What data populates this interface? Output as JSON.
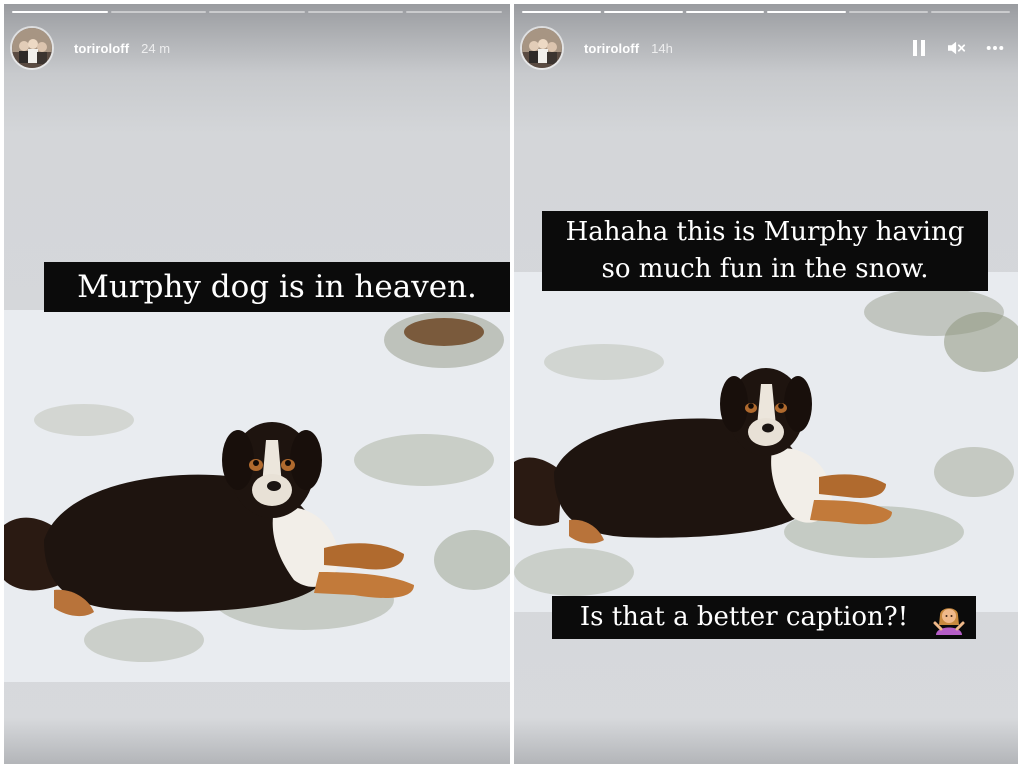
{
  "stories": [
    {
      "username": "toriroloff",
      "timestamp": "24 m",
      "caption": "Murphy dog is in heaven.",
      "progress": {
        "segments": 5,
        "completed": 1
      },
      "avatar_icon": "profile-photo"
    },
    {
      "username": "toriroloff",
      "timestamp": "14h",
      "caption_top_line1": "Hahaha this is Murphy having",
      "caption_top_line2": "so much fun in the snow.",
      "caption_bottom": "Is that a better caption?!",
      "caption_emoji_icon": "woman-shrugging-emoji",
      "progress": {
        "segments": 6,
        "completed": 4
      },
      "controls": [
        "pause-icon",
        "mute-icon",
        "more-options-icon"
      ]
    }
  ],
  "colors": {
    "caption_bg": "#0b0b0b",
    "caption_text": "#ffffff",
    "story_bg": "#d7d9dc"
  }
}
